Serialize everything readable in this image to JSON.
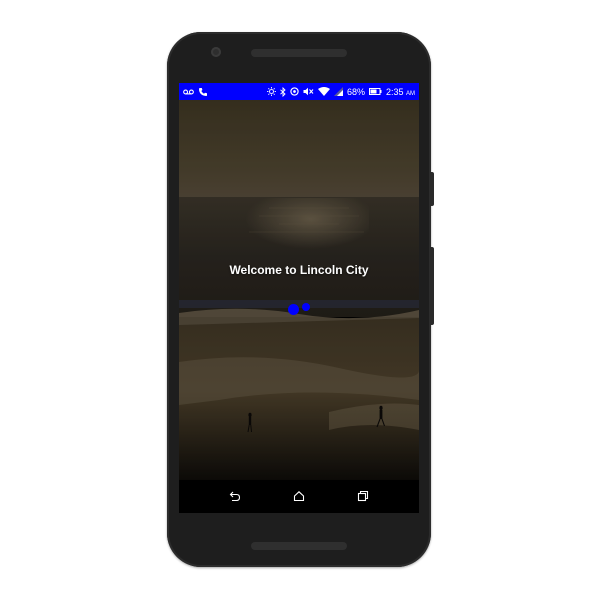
{
  "colors": {
    "status_bar": "#0000ff",
    "loading_dot": "#0000ff",
    "phone_body": "#1e1e1e",
    "nav_bar": "#000000"
  },
  "status_bar": {
    "left_icons": [
      "voicemail-icon",
      "phone-call-icon"
    ],
    "right_icons": [
      "brightness-icon",
      "bluetooth-icon",
      "data-saver-icon",
      "mute-icon",
      "wifi-icon",
      "signal-icon"
    ],
    "battery_percent": "68%",
    "time": "2:35",
    "ampm": "AM"
  },
  "main": {
    "welcome_text": "Welcome to Lincoln City",
    "background": "beach-sunset-photo",
    "loading_indicator": "two-dot-spinner"
  },
  "nav_bar": {
    "buttons": [
      "back-icon",
      "home-icon",
      "recents-icon"
    ]
  }
}
